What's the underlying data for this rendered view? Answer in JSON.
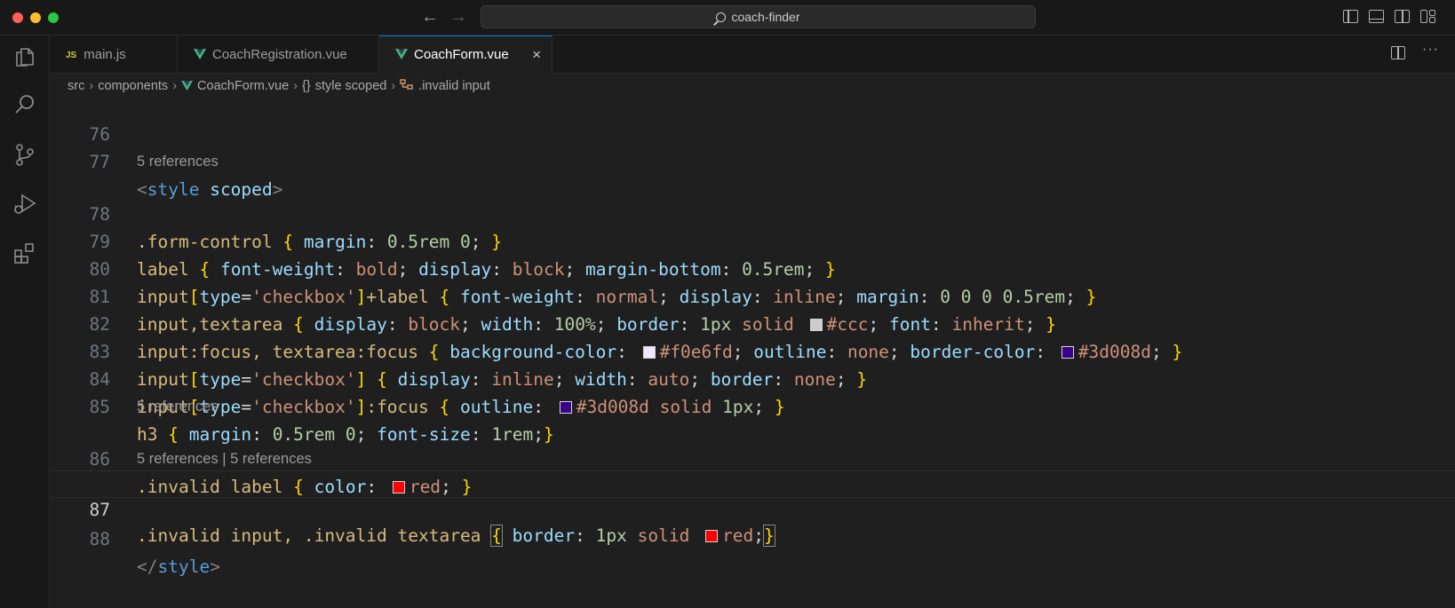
{
  "window": {
    "search_text": "coach-finder"
  },
  "tabs": [
    {
      "label": "main.js",
      "badge": "JS"
    },
    {
      "label": "CoachRegistration.vue"
    },
    {
      "label": "CoachForm.vue",
      "close": "×"
    }
  ],
  "breadcrumbs": {
    "src": "src",
    "components": "components",
    "file": "CoachForm.vue",
    "block_icon": "{}",
    "block": "style scoped",
    "rule": ".invalid input"
  },
  "editor": {
    "line_numbers": [
      "76",
      "77",
      "78",
      "79",
      "80",
      "81",
      "82",
      "83",
      "84",
      "85",
      "86",
      "87",
      "88"
    ],
    "codelens": [
      "5 references",
      "5 references",
      "5 references | 5 references"
    ],
    "tokens": {
      "l77": [
        "<",
        "style",
        "scoped",
        ">"
      ],
      "l78": [
        ".form-control",
        "{",
        "margin",
        ":",
        "0.5rem",
        "0",
        ";",
        "}"
      ],
      "l79": [
        "label",
        "{",
        "font-weight",
        ":",
        "bold",
        ";",
        "display",
        ":",
        "block",
        ";",
        "margin-bottom",
        ":",
        "0.5rem",
        ";",
        "}"
      ],
      "l80": [
        "input",
        "[",
        "type",
        "=",
        "'checkbox'",
        "]",
        "+label",
        "{",
        "font-weight",
        ":",
        "normal",
        ";",
        "display",
        ":",
        "inline",
        ";",
        "margin",
        ":",
        "0 0 0 0.5rem",
        ";",
        "}"
      ],
      "l81": [
        "input,textarea",
        "{",
        "display",
        ":",
        "block",
        ";",
        "width",
        ":",
        "100%",
        ";",
        "border",
        ":",
        "1px",
        "solid",
        "#ccc",
        ";",
        "font",
        ":",
        "inherit",
        ";",
        "}"
      ],
      "l82": [
        "input:focus, textarea:focus",
        "{",
        "background-color",
        ":",
        "#f0e6fd",
        ";",
        "outline",
        ":",
        "none",
        ";",
        "border-color",
        ":",
        "#3d008d",
        ";",
        "}"
      ],
      "l83": [
        "input",
        "[",
        "type",
        "=",
        "'checkbox'",
        "]",
        "{",
        "display",
        ":",
        "inline",
        ";",
        "width",
        ":",
        "auto",
        ";",
        "border",
        ":",
        "none",
        ";",
        "}"
      ],
      "l84": [
        "input",
        "[",
        "type",
        "=",
        "'checkbox'",
        "]",
        ":focus",
        "{",
        "outline",
        ":",
        "#3d008d",
        "solid",
        "1px",
        ";",
        "}"
      ],
      "l85": [
        "h3",
        "{",
        "margin",
        ":",
        "0.5rem",
        "0",
        ";",
        "font-size",
        ":",
        "1rem",
        ";",
        "}"
      ],
      "l86": [
        ".invalid label",
        "{",
        "color",
        ":",
        "red",
        ";",
        "}"
      ],
      "l87": [
        ".invalid input, .invalid textarea",
        "{",
        "border",
        ":",
        "1px",
        "solid",
        "red",
        ";",
        "}"
      ],
      "l88": [
        "</",
        "style",
        ">"
      ]
    }
  },
  "colors": {
    "swatch_ccc": "#cccccc",
    "swatch_f0e6fd": "#f0e6fd",
    "swatch_3d008d": "#3d008d",
    "swatch_red": "#ff0000",
    "accent": "#0078d4"
  }
}
